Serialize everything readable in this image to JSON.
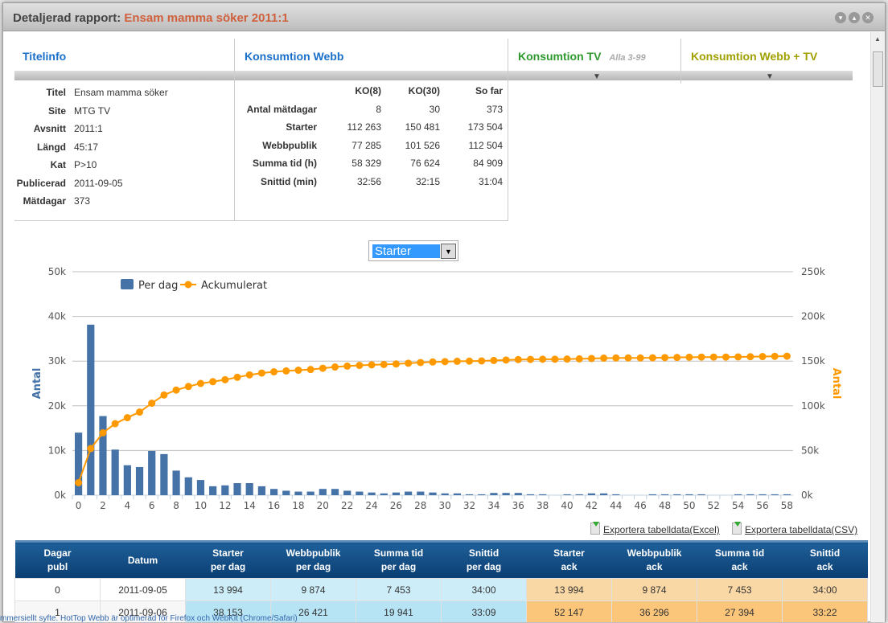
{
  "window": {
    "title_prefix": "Detaljerad rapport:",
    "title_name": "Ensam mamma söker 2011:1",
    "buttons": [
      "minimize",
      "maximize",
      "close"
    ]
  },
  "panels": {
    "titleinfo": "Titelinfo",
    "webb": "Konsumtion Webb",
    "tv": "Konsumtion TV",
    "tv_sub": "Alla 3-99",
    "webbtv": "Konsumtion Webb + TV"
  },
  "titleinfo": [
    {
      "k": "Titel",
      "v": "Ensam mamma söker"
    },
    {
      "k": "Site",
      "v": "MTG TV"
    },
    {
      "k": "Avsnitt",
      "v": "2011:1"
    },
    {
      "k": "Längd",
      "v": "45:17"
    },
    {
      "k": "Kat",
      "v": "P>10"
    },
    {
      "k": "Publicerad",
      "v": "2011-09-05"
    },
    {
      "k": "Mätdagar",
      "v": "373"
    }
  ],
  "webb": {
    "headers": [
      "",
      "KO(8)",
      "KO(30)",
      "So far"
    ],
    "rows": [
      [
        "Antal mätdagar",
        "8",
        "30",
        "373"
      ],
      [
        "Starter",
        "112 263",
        "150 481",
        "173 504"
      ],
      [
        "Webbpublik",
        "77 285",
        "101 526",
        "112 504"
      ],
      [
        "Summa tid (h)",
        "58 329",
        "76 624",
        "84 909"
      ],
      [
        "Snittid (min)",
        "32:56",
        "32:15",
        "31:04"
      ]
    ]
  },
  "select": {
    "value": "Starter"
  },
  "colors": {
    "bar": "#4572a7",
    "line": "#ff9900",
    "left_axis": "#4572a7",
    "right_axis": "#ff9900"
  },
  "chart_data": {
    "type": "bar+line",
    "legend": [
      "Per dag",
      "Ackumulerat"
    ],
    "legend_placement": "top-left",
    "ylabel_left": "Antal",
    "ylabel_right": "Antal",
    "ylim_left": [
      0,
      50000
    ],
    "ylim_right": [
      0,
      250000
    ],
    "yticks_left": [
      "0k",
      "10k",
      "20k",
      "30k",
      "40k",
      "50k"
    ],
    "yticks_right": [
      "0k",
      "50k",
      "100k",
      "150k",
      "200k",
      "250k"
    ],
    "x_tick_labels": [
      "0",
      "2",
      "4",
      "6",
      "8",
      "10",
      "12",
      "14",
      "16",
      "18",
      "20",
      "22",
      "24",
      "26",
      "28",
      "30",
      "32",
      "34",
      "36",
      "38",
      "40",
      "42",
      "44",
      "46",
      "48",
      "50",
      "52",
      "54",
      "56",
      "58"
    ],
    "x": [
      0,
      1,
      2,
      3,
      4,
      5,
      6,
      7,
      8,
      9,
      10,
      11,
      12,
      13,
      14,
      15,
      16,
      17,
      18,
      19,
      20,
      21,
      22,
      23,
      24,
      25,
      26,
      27,
      28,
      29,
      30,
      31,
      32,
      33,
      34,
      35,
      36,
      37,
      38,
      39,
      40,
      41,
      42,
      43,
      44,
      45,
      46,
      47,
      48,
      49,
      50,
      51,
      52,
      53,
      54,
      55,
      56,
      57,
      58
    ],
    "grid": true,
    "series": [
      {
        "name": "Per dag",
        "type": "bar",
        "values": [
          13994,
          38153,
          17700,
          10200,
          6700,
          6300,
          9900,
          9200,
          5500,
          4000,
          3400,
          2000,
          2200,
          2700,
          2700,
          2000,
          1400,
          1000,
          800,
          800,
          1400,
          1400,
          1000,
          800,
          600,
          400,
          600,
          800,
          800,
          600,
          400,
          400,
          200,
          200,
          500,
          500,
          500,
          200,
          200,
          0,
          200,
          200,
          400,
          400,
          200,
          0,
          0,
          200,
          200,
          200,
          200,
          200,
          0,
          0,
          200,
          200,
          200,
          200,
          200
        ]
      },
      {
        "name": "Ackumulerat",
        "type": "line",
        "values": [
          13994,
          52147,
          69800,
          80000,
          86700,
          93000,
          102900,
          112100,
          117600,
          121600,
          125000,
          127000,
          129200,
          131900,
          134600,
          136600,
          138000,
          139000,
          139800,
          140600,
          142000,
          143400,
          144400,
          145200,
          145800,
          146200,
          146800,
          147600,
          148400,
          149000,
          149400,
          149800,
          150000,
          150200,
          150700,
          151200,
          151700,
          151900,
          152100,
          152100,
          152300,
          152500,
          152900,
          153300,
          153500,
          153500,
          153500,
          153700,
          153900,
          154100,
          154300,
          154500,
          154500,
          154500,
          154700,
          154900,
          155100,
          155300,
          155500
        ]
      }
    ]
  },
  "export": {
    "excel": "Exportera tabelldata(Excel)",
    "csv": "Exportera tabelldata(CSV)"
  },
  "table": {
    "headers": [
      [
        "Dagar",
        "publ"
      ],
      [
        "Datum",
        ""
      ],
      [
        "Starter",
        "per dag"
      ],
      [
        "Webbpublik",
        "per dag"
      ],
      [
        "Summa tid",
        "per dag"
      ],
      [
        "Snittid",
        "per dag"
      ],
      [
        "Starter",
        "ack"
      ],
      [
        "Webbpublik",
        "ack"
      ],
      [
        "Summa tid",
        "ack"
      ],
      [
        "Snittid",
        "ack"
      ]
    ],
    "rows": [
      [
        "0",
        "2011-09-05",
        "13 994",
        "9 874",
        "7 453",
        "34:00",
        "13 994",
        "9 874",
        "7 453",
        "34:00"
      ],
      [
        "1",
        "2011-09-06",
        "38 153",
        "26 421",
        "19 941",
        "33:09",
        "52 147",
        "36 296",
        "27 394",
        "33:22"
      ]
    ]
  },
  "footer": "mmersiellt syfte. HotTop Webb är optimerad för Firefox och WebKit (Chrome/Safari)"
}
